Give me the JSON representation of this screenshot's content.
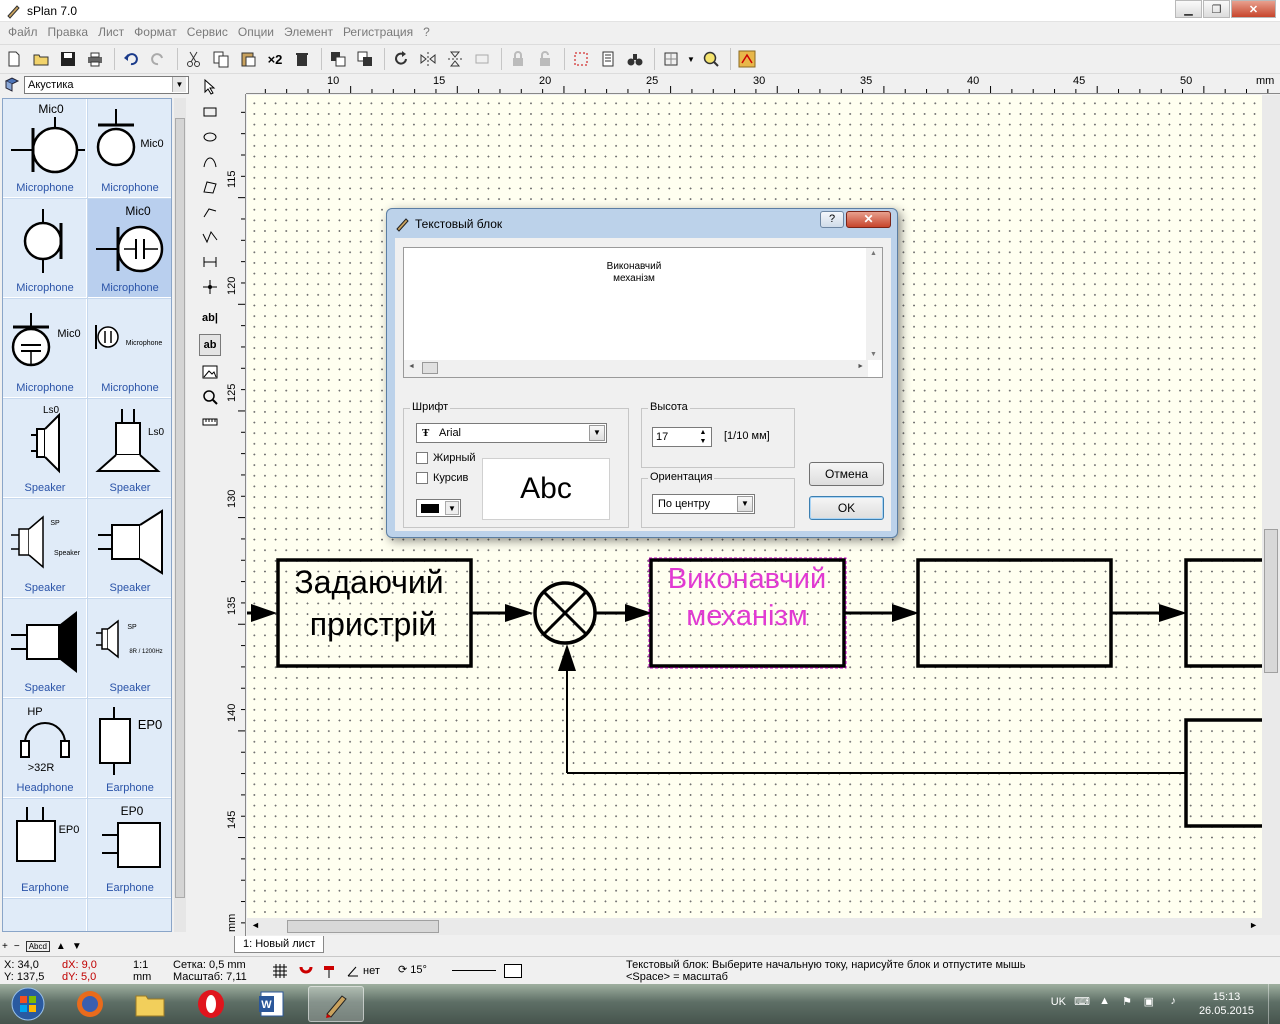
{
  "window": {
    "title": "sPlan 7.0"
  },
  "menu": [
    "Файл",
    "Правка",
    "Лист",
    "Формат",
    "Сервис",
    "Опции",
    "Элемент",
    "Регистрация",
    "?"
  ],
  "toolbar": {
    "x2_label": "×2"
  },
  "library": {
    "category": "Акустика",
    "items": [
      {
        "label": "Microphone",
        "tag": "Mic0"
      },
      {
        "label": "Microphone",
        "tag": "Mic0"
      },
      {
        "label": "Microphone",
        "tag": ""
      },
      {
        "label": "Microphone",
        "tag": "Mic0"
      },
      {
        "label": "Microphone",
        "tag": "Mic0"
      },
      {
        "label": "Microphone",
        "tag": "Microphone"
      },
      {
        "label": "Speaker",
        "tag": "Ls0"
      },
      {
        "label": "Speaker",
        "tag": "Ls0"
      },
      {
        "label": "Speaker",
        "tag": "SP"
      },
      {
        "label": "Speaker",
        "tag": ""
      },
      {
        "label": "Speaker",
        "tag": ""
      },
      {
        "label": "Speaker",
        "tag": "SP"
      },
      {
        "label": "Headphone",
        "tag": "HP"
      },
      {
        "label": "Earphone",
        "tag": "EP0"
      },
      {
        "label": "Earphone",
        "tag": "EP0"
      },
      {
        "label": "Earphone",
        "tag": "EP0"
      }
    ],
    "subtags": {
      "speaker1": "Speaker",
      "speaker2": "8R / 1200Hz",
      "headphone": ">32R"
    },
    "bottom_label": "Abcd"
  },
  "tools": {
    "text1": "ab|",
    "text2": "ab"
  },
  "ruler": {
    "top": [
      "10",
      "15",
      "20",
      "25",
      "30",
      "35",
      "40",
      "45",
      "50",
      "mm"
    ],
    "left": [
      "115",
      "120",
      "125",
      "130",
      "135",
      "140",
      "145",
      "mm"
    ]
  },
  "diagram": {
    "block1": [
      "Задаючий",
      "пристрій"
    ],
    "block2": [
      "Виконавчий",
      "механізм"
    ],
    "block2_color": "#e13ad2"
  },
  "dialog": {
    "title": "Текстовый блок",
    "help": "?",
    "text": "Виконавчий\nмеханізм",
    "font_group": "Шрифт",
    "font_name": "Arial",
    "bold": "Жирный",
    "italic": "Курсив",
    "preview": "Abc",
    "height_group": "Высота",
    "height_value": "17",
    "height_unit": "[1/10 мм]",
    "orientation_group": "Ориентация",
    "orientation_value": "По центру",
    "cancel": "Отмена",
    "ok": "OK"
  },
  "sheet_tab": "1: Новый лист",
  "status": {
    "x": "X: 34,0",
    "y": "Y: 137,5",
    "dx": "dX: 9,0",
    "dy": "dY: 5,0",
    "scale_ratio": "1:1",
    "scale_unit": "mm",
    "grid": "Сетка: 0,5 mm",
    "zoom": "Масштаб:  7,11",
    "angle_mode": "нет",
    "rotate": "15°",
    "hint1": "Текстовый блок: Выберите начальную току, нарисуйте блок и отпустите мышь",
    "hint2": "<Space> = масштаб"
  },
  "taskbar": {
    "lang": "UK",
    "time": "15:13",
    "date": "26.05.2015"
  }
}
